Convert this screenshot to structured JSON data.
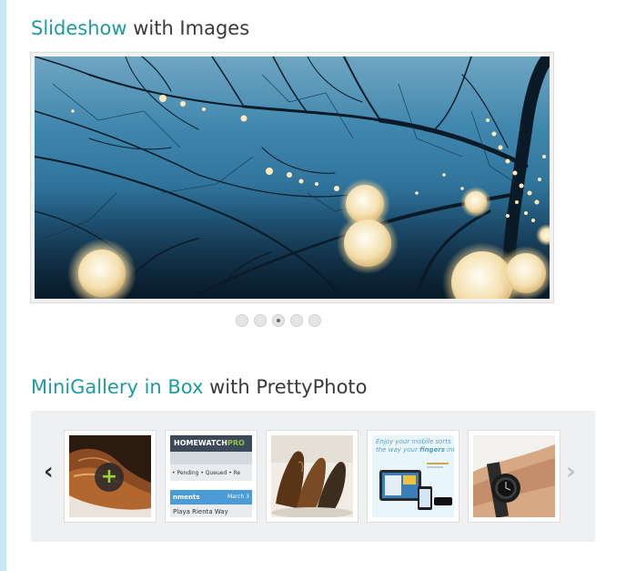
{
  "slideshow": {
    "title_accent": "Slideshow",
    "title_rest": " with Images",
    "dots": [
      {
        "label": "Slide 1",
        "active": false
      },
      {
        "label": "Slide 2",
        "active": false
      },
      {
        "label": "Slide 3",
        "active": true
      },
      {
        "label": "Slide 4",
        "active": false
      },
      {
        "label": "Slide 5",
        "active": false
      }
    ]
  },
  "minigallery": {
    "title_accent": "MiniGallery in Box",
    "title_rest": " with PrettyPhoto",
    "prev_icon": "‹",
    "next_icon": "›",
    "hover_icon": "+",
    "thumbs": [
      {
        "name": "brown-shoes"
      },
      {
        "name": "homewatchpro-app",
        "logo_a": "HOMEWATCH",
        "logo_b": "PRO",
        "status": "• Pending  • Queued  • Re",
        "section": "nments",
        "date": "March 3",
        "address": "Playa Rienta Way"
      },
      {
        "name": "leather-shoes"
      },
      {
        "name": "mobile-app-ad",
        "line1": "Enjoy your mobile sorts",
        "line2a": "the way your ",
        "line2b": "fingers",
        "line2c": " inte"
      },
      {
        "name": "wristwatch"
      }
    ]
  },
  "colors": {
    "accent": "#1f9aa3",
    "left_strip": "#c6e9f5",
    "gallery_bg": "#eef0f2"
  }
}
